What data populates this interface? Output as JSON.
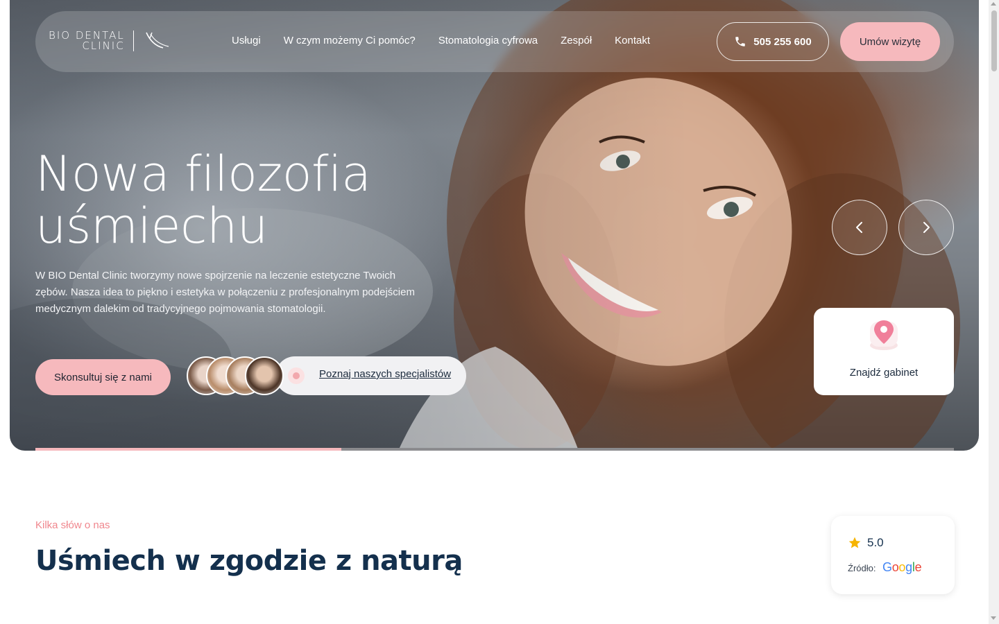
{
  "brand": {
    "line1": "BIO DENTAL",
    "line2": "CLINIC"
  },
  "nav": {
    "links": [
      "Usługi",
      "W czym możemy Ci pomóc?",
      "Stomatologia cyfrowa",
      "Zespół",
      "Kontakt"
    ],
    "phone": "505 255 600",
    "book_label": "Umów wizytę"
  },
  "hero": {
    "title_line1": "Nowa filozofia",
    "title_line2": "uśmiechu",
    "description": "W BIO Dental Clinic tworzymy nowe spojrzenie na leczenie estetyczne Twoich zębów. Nasza idea to piękno i estetyka w połączeniu z profesjonalnym podejściem medycznym dalekim od tradycyjnego pojmowania stomatologii.",
    "consult_label": "Skonsultuj się z nami",
    "specialists_label": "Poznaj naszych specjalistów",
    "find_office_label": "Znajdź gabinet",
    "slide_progress": 0.333
  },
  "about": {
    "eyebrow": "Kilka słów o nas",
    "title": "Uśmiech w zgodzie z naturą"
  },
  "rating": {
    "value": "5.0",
    "source_label": "Źródło:",
    "source_name": "Google"
  },
  "colors": {
    "accent_pink": "#f6b9bd",
    "eyebrow_pink": "#f0868d",
    "heading_navy": "#14304d",
    "star_gold": "#f6b400"
  },
  "icons": [
    "phone-icon",
    "chevron-left-icon",
    "chevron-right-icon",
    "map-pin-icon",
    "star-icon",
    "logo-mark-icon"
  ]
}
